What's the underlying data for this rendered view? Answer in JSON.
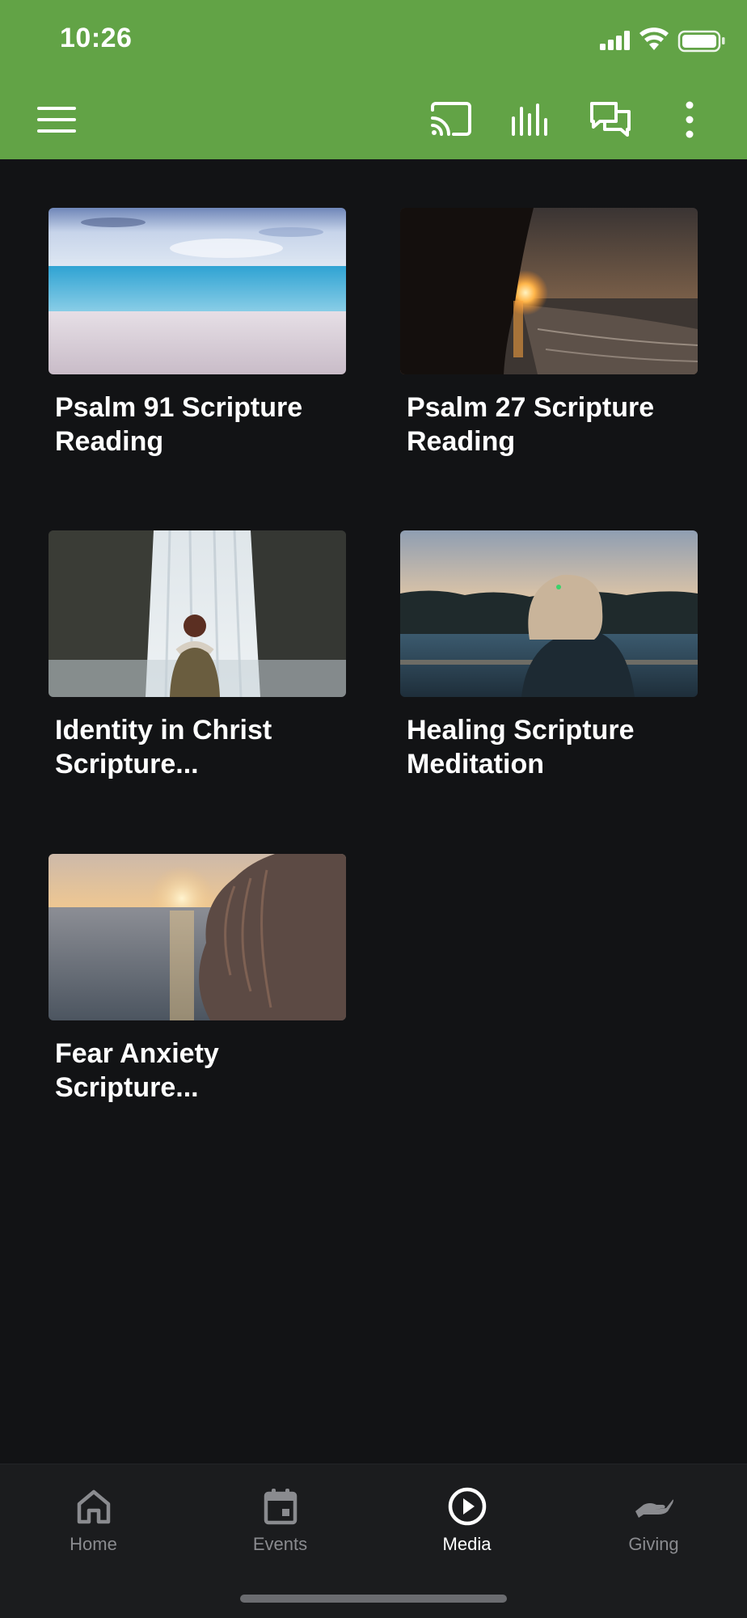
{
  "status_bar": {
    "time": "10:26"
  },
  "toolbar": {
    "icons": [
      "menu-icon",
      "cast-icon",
      "audio-bars-icon",
      "chat-icon",
      "more-vertical-icon"
    ]
  },
  "colors": {
    "header": "#62a346",
    "background": "#121315",
    "nav_background": "#1b1c1e",
    "nav_inactive": "#8a8b8f",
    "nav_active": "#ffffff"
  },
  "media": {
    "items": [
      {
        "title": "Psalm 91 Scripture Reading",
        "thumbnail": "beach-ocean-image"
      },
      {
        "title": "Psalm 27 Scripture Reading",
        "thumbnail": "sunset-shoreline-image"
      },
      {
        "title": "Identity in Christ Scripture...",
        "thumbnail": "waterfall-person-image"
      },
      {
        "title": "Healing Scripture Meditation",
        "thumbnail": "woman-lake-sunset-image"
      },
      {
        "title": "Fear Anxiety Scripture...",
        "thumbnail": "hair-sea-sunset-image"
      }
    ]
  },
  "bottom_nav": {
    "items": [
      {
        "label": "Home",
        "icon": "home-icon",
        "active": false
      },
      {
        "label": "Events",
        "icon": "calendar-icon",
        "active": false
      },
      {
        "label": "Media",
        "icon": "play-circle-icon",
        "active": true
      },
      {
        "label": "Giving",
        "icon": "giving-hand-icon",
        "active": false
      }
    ]
  }
}
